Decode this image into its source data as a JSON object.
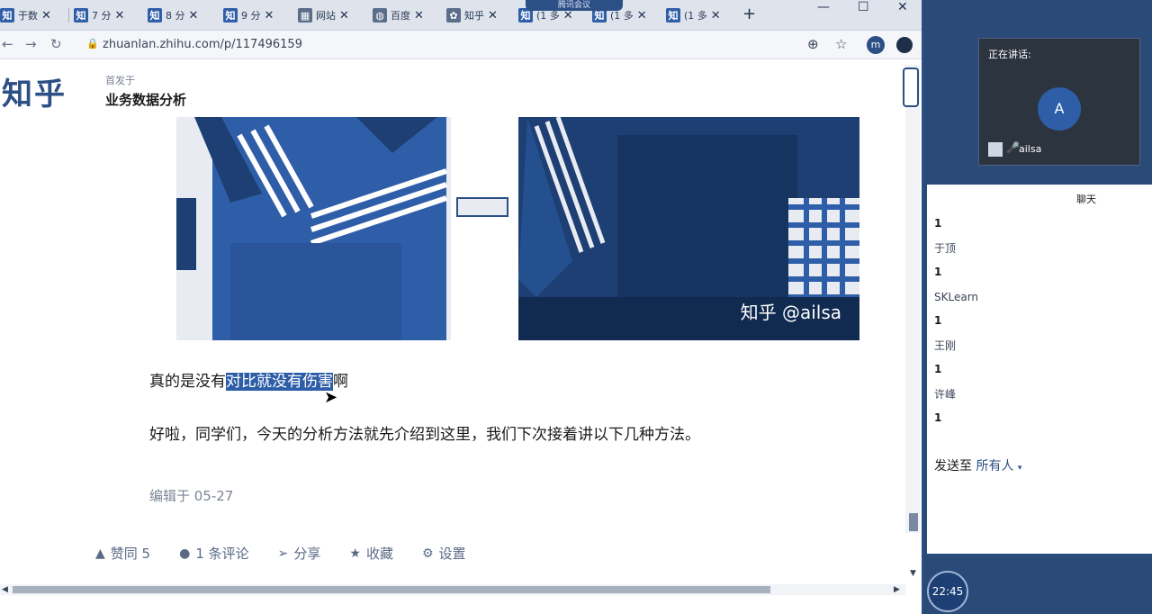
{
  "browser": {
    "tabs": [
      {
        "icon": "知",
        "label": "于数"
      },
      {
        "icon": "知",
        "label": "7 分"
      },
      {
        "icon": "知",
        "label": "8 分"
      },
      {
        "icon": "知",
        "label": "9 分"
      },
      {
        "icon": "▦",
        "label": "网站"
      },
      {
        "icon": "◍",
        "label": "百度"
      },
      {
        "icon": "✿",
        "label": "知乎"
      },
      {
        "icon": "知",
        "label": "(1 多"
      },
      {
        "icon": "知",
        "label": "(1 多"
      },
      {
        "icon": "知",
        "label": "(1 多"
      }
    ],
    "meeting_pill": "腾讯会议",
    "url": "zhuanlan.zhihu.com/p/117496159",
    "profile_initial": "m"
  },
  "article": {
    "logo": "知乎",
    "published_in": "首发于",
    "column_title": "业务数据分析",
    "watermark": "知乎 @ailsa",
    "line1_before": "真的是没有",
    "line1_highlight": "对比就没有伤害",
    "line1_after": "啊",
    "line2": "好啦，同学们，今天的分析方法就先介绍到这里，我们下次接着讲以下几种方法。",
    "edited": "编辑于 05-27"
  },
  "actions": {
    "upvote": "赞同 5",
    "comment": "1 条评论",
    "share": "分享",
    "favorite": "收藏",
    "settings": "设置"
  },
  "meeting": {
    "speaking_label": "正在讲话:",
    "avatar_initial": "A",
    "speaker_name": "ailsa",
    "chat_title": "聊天",
    "chat": [
      {
        "kind": "msg",
        "text": "1"
      },
      {
        "kind": "sender",
        "text": "于顶"
      },
      {
        "kind": "msg",
        "text": "1"
      },
      {
        "kind": "sender",
        "text": "SKLearn"
      },
      {
        "kind": "msg",
        "text": "1"
      },
      {
        "kind": "sender",
        "text": "王刚"
      },
      {
        "kind": "msg",
        "text": "1"
      },
      {
        "kind": "sender",
        "text": "许峰"
      },
      {
        "kind": "msg",
        "text": "1"
      }
    ],
    "send_to_label": "发送至",
    "send_target": "所有人",
    "clock": "22:45"
  },
  "colors": {
    "accent": "#2f5ea8",
    "desktop": "#2a4a78"
  }
}
